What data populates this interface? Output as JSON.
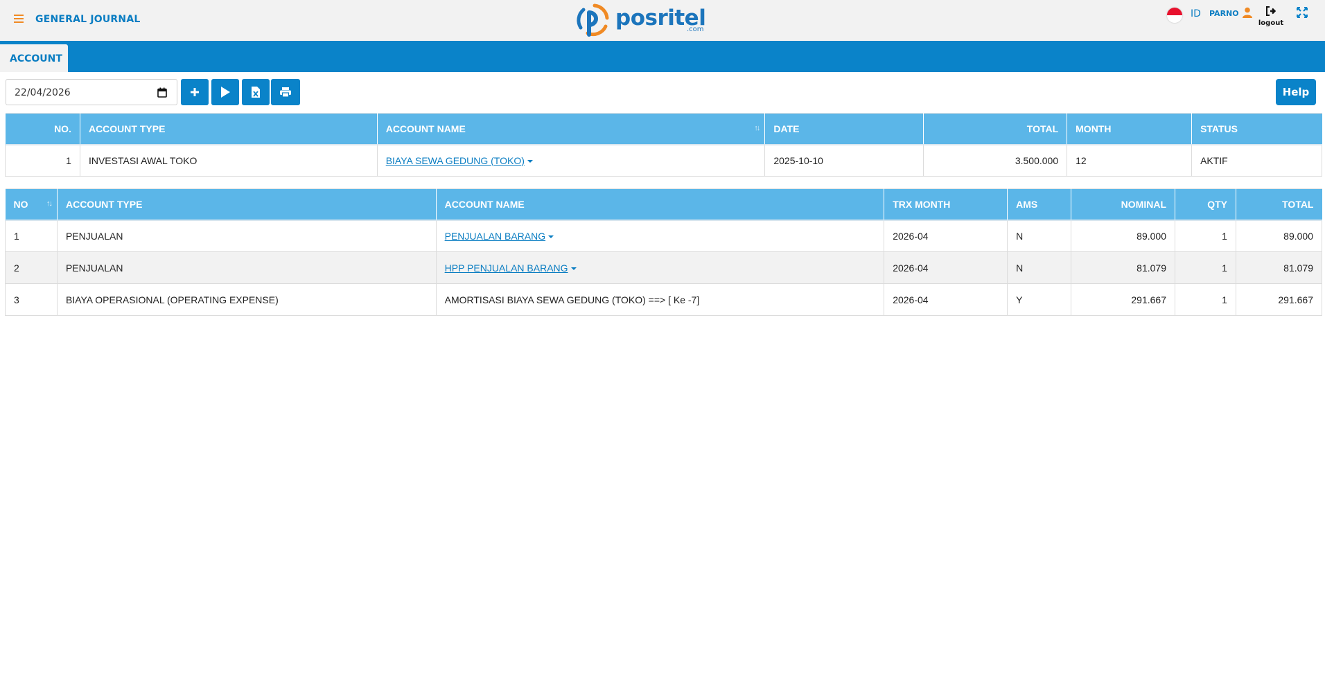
{
  "header": {
    "title": "GENERAL JOURNAL",
    "logo_text": "posritel",
    "logo_sub": ".com",
    "language": "ID",
    "username": "PARNO",
    "logout_label": "logout"
  },
  "tabs": [
    {
      "label": "ACCOUNT",
      "active": true
    }
  ],
  "toolbar": {
    "date_value": "22/04/2026",
    "help_label": "Help",
    "buttons": [
      "plus-icon",
      "play-icon",
      "excel-icon",
      "print-icon"
    ]
  },
  "colors": {
    "primary": "#0a83c9",
    "header_cell": "#5bb6e8",
    "accent_orange": "#f08a24",
    "link": "#0a7dc2"
  },
  "table1": {
    "columns": [
      "NO.",
      "ACCOUNT TYPE",
      "ACCOUNT NAME",
      "DATE",
      "TOTAL",
      "MONTH",
      "STATUS"
    ],
    "rows": [
      {
        "no": "1",
        "account_type": "INVESTASI AWAL TOKO",
        "account_name": "BIAYA SEWA GEDUNG (TOKO)",
        "date": "2025-10-10",
        "total": "3.500.000",
        "month": "12",
        "status": "AKTIF"
      }
    ]
  },
  "table2": {
    "columns": [
      "NO",
      "ACCOUNT TYPE",
      "ACCOUNT NAME",
      "TRX MONTH",
      "AMS",
      "NOMINAL",
      "QTY",
      "TOTAL"
    ],
    "rows": [
      {
        "no": "1",
        "account_type": "PENJUALAN",
        "account_name": "PENJUALAN BARANG",
        "trx_month": "2026-04",
        "ams": "N",
        "nominal": "89.000",
        "qty": "1",
        "total": "89.000"
      },
      {
        "no": "2",
        "account_type": "PENJUALAN",
        "account_name": "HPP PENJUALAN BARANG",
        "trx_month": "2026-04",
        "ams": "N",
        "nominal": "81.079",
        "qty": "1",
        "total": "81.079"
      },
      {
        "no": "3",
        "account_type": "BIAYA OPERASIONAL (OPERATING EXPENSE)",
        "account_name": "AMORTISASI BIAYA SEWA GEDUNG (TOKO) ==> [ Ke -7]",
        "trx_month": "2026-04",
        "ams": "Y",
        "nominal": "291.667",
        "qty": "1",
        "total": "291.667"
      }
    ]
  }
}
